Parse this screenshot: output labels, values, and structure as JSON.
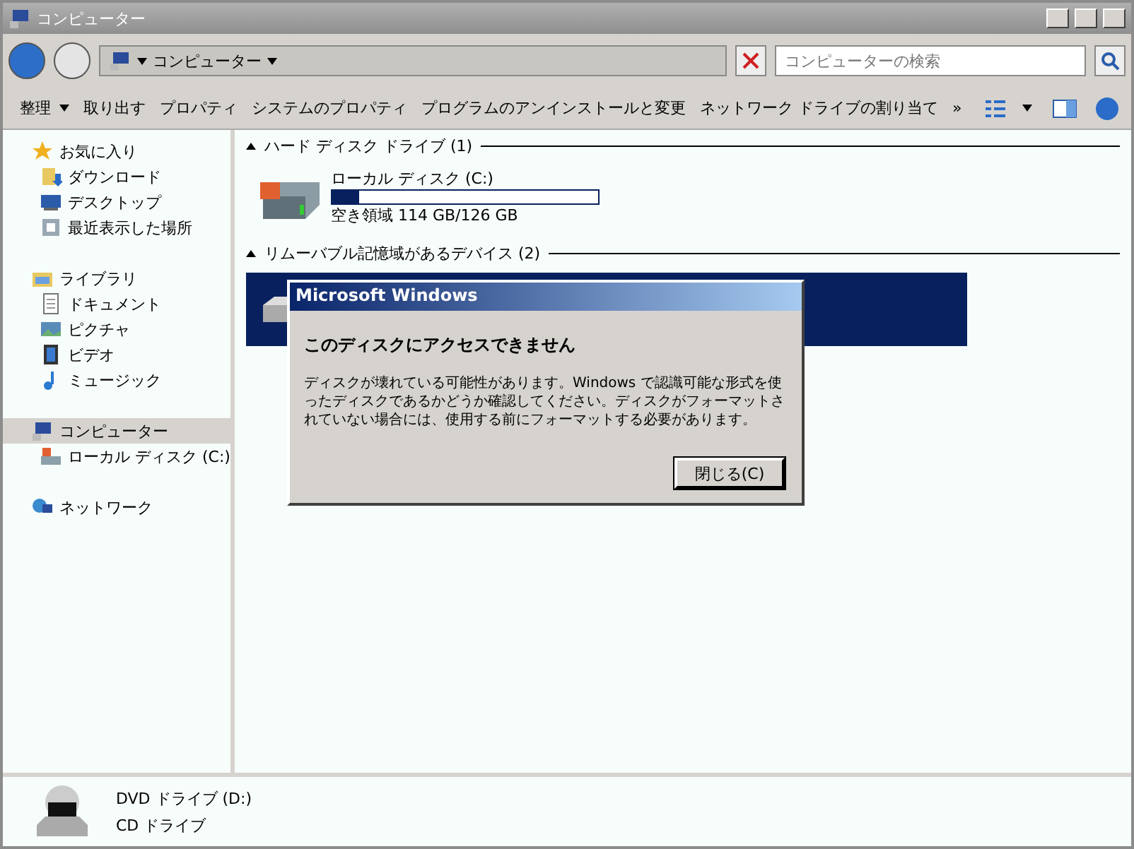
{
  "window": {
    "title": "コンピューター"
  },
  "address": {
    "path": "コンピューター",
    "search_placeholder": "コンピューターの検索"
  },
  "toolbar": {
    "items": [
      {
        "label": "整理",
        "dropdown": true
      },
      {
        "label": "取り出す",
        "dropdown": false
      },
      {
        "label": "プロパティ",
        "dropdown": false
      },
      {
        "label": "システムのプロパティ",
        "dropdown": false
      },
      {
        "label": "プログラムのアンインストールと変更",
        "dropdown": false
      },
      {
        "label": "ネットワーク ドライブの割り当て",
        "dropdown": false
      }
    ],
    "more": "»"
  },
  "sidebar": {
    "groups": [
      {
        "label": "お気に入り",
        "kind": "star",
        "selected": false,
        "children": [
          {
            "label": "ダウンロード",
            "kind": "download",
            "selected": false
          },
          {
            "label": "デスクトップ",
            "kind": "desktop",
            "selected": false
          },
          {
            "label": "最近表示した場所",
            "kind": "recent",
            "selected": false
          }
        ]
      },
      {
        "label": "ライブラリ",
        "kind": "library",
        "selected": false,
        "children": [
          {
            "label": "ドキュメント",
            "kind": "document",
            "selected": false
          },
          {
            "label": "ピクチャ",
            "kind": "picture",
            "selected": false
          },
          {
            "label": "ビデオ",
            "kind": "video",
            "selected": false
          },
          {
            "label": "ミュージック",
            "kind": "music",
            "selected": false
          }
        ]
      },
      {
        "label": "コンピューター",
        "kind": "computer",
        "selected": true,
        "children": [
          {
            "label": "ローカル ディスク (C:)",
            "kind": "disk",
            "selected": false
          }
        ]
      },
      {
        "label": "ネットワーク",
        "kind": "network",
        "selected": false
      }
    ]
  },
  "content": {
    "sections": [
      {
        "title": "ハード ディスク ドライブ (1)",
        "drives": [
          {
            "kind": "disk",
            "name": "ローカル ディスク (C:)",
            "level": 0.1,
            "free": "空き領域 114 GB/126 GB",
            "selected": false
          }
        ]
      },
      {
        "title": "リムーバブル記憶域があるデバイス (2)",
        "drives": [
          {
            "kind": "optical",
            "selected": true
          }
        ]
      }
    ]
  },
  "dialog": {
    "title": "Microsoft Windows",
    "heading": "このディスクにアクセスできません",
    "message": "ディスクが壊れている可能性があります。Windows で認識可能な形式を使ったディスクであるかどうか確認してください。ディスクがフォーマットされていない場合には、使用する前にフォーマットする必要があります。",
    "button": "閉じる(C)"
  },
  "details": {
    "name": "DVD ドライブ (D:)",
    "type": "CD ドライブ"
  }
}
